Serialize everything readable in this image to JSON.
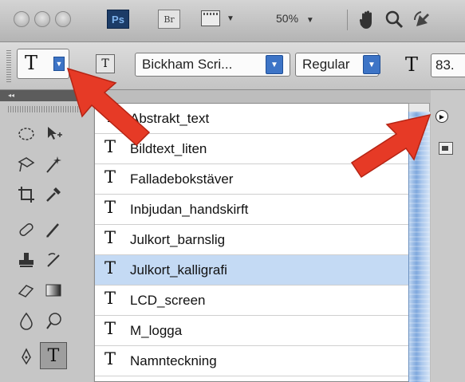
{
  "app_bar": {
    "ps_label": "Ps",
    "br_label": "Br",
    "zoom_value": "50%",
    "zoom_caret": "▼",
    "screen_caret": "▼",
    "hand_icon": "hand-icon",
    "zoom_icon": "magnifier-icon",
    "rotate_icon": "rotate-view-icon"
  },
  "options_bar": {
    "tool_glyph": "T",
    "orientation_glyph": "T",
    "font_family": "Bickham Scri...",
    "font_style": "Regular",
    "size_glyph": "T",
    "font_size": "83."
  },
  "tool_panel": {
    "collapse_glyph": "◂◂"
  },
  "presets_list": {
    "glyph": "T",
    "items": [
      {
        "label": "Abstrakt_text"
      },
      {
        "label": "Bildtext_liten"
      },
      {
        "label": "Falladebokstäver"
      },
      {
        "label": "Inbjudan_handskirft"
      },
      {
        "label": "Julkort_barnslig"
      },
      {
        "label": "Julkort_kalligrafi"
      },
      {
        "label": "LCD_screen"
      },
      {
        "label": "M_logga"
      },
      {
        "label": "Namnteckning"
      }
    ],
    "selected_index": 5,
    "menu_glyph": "▶"
  },
  "colors": {
    "ps_bg": "#1c3c67",
    "accent_blue": "#3d74c6",
    "selected_row": "#c4daf4",
    "arrow_red": "#e63a26"
  }
}
